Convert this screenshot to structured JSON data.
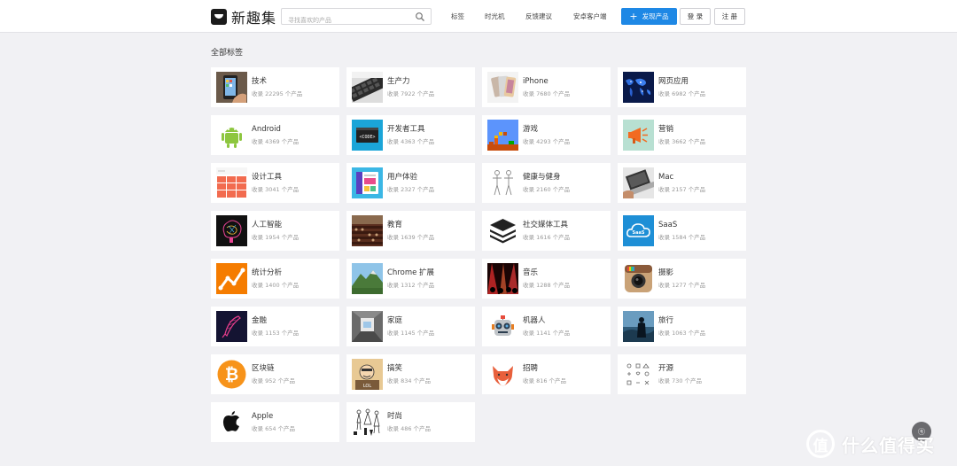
{
  "header": {
    "logo_text": "新趣集",
    "search_placeholder": "寻找喜欢的产品",
    "nav": [
      "标签",
      "时光机",
      "反馈建议",
      "安卓客户端"
    ],
    "post_button": "发现产品",
    "login": "登 录",
    "register": "注 册"
  },
  "main": {
    "section_title": "全部标签",
    "tags": [
      {
        "name": "技术",
        "count": "收录 22295 个产品",
        "icon": "iphone-hand-icon"
      },
      {
        "name": "生产力",
        "count": "收录 7922 个产品",
        "icon": "keyboard-icon"
      },
      {
        "name": "iPhone",
        "count": "收录 7680 个产品",
        "icon": "iphone-devices-icon"
      },
      {
        "name": "网页应用",
        "count": "收录 6982 个产品",
        "icon": "world-map-icon"
      },
      {
        "name": "Android",
        "count": "收录 4369 个产品",
        "icon": "android-robot-icon"
      },
      {
        "name": "开发者工具",
        "count": "收录 4363 个产品",
        "icon": "code-window-icon"
      },
      {
        "name": "游戏",
        "count": "收录 4293 个产品",
        "icon": "pixel-game-icon"
      },
      {
        "name": "营销",
        "count": "收录 3662 个产品",
        "icon": "megaphone-icon"
      },
      {
        "name": "设计工具",
        "count": "收录 3041 个产品",
        "icon": "design-grid-icon"
      },
      {
        "name": "用户体验",
        "count": "收录 2327 个产品",
        "icon": "ux-screen-icon"
      },
      {
        "name": "健康与健身",
        "count": "收录 2160 个产品",
        "icon": "body-figure-icon"
      },
      {
        "name": "Mac",
        "count": "收录 2157 个产品",
        "icon": "macbook-icon"
      },
      {
        "name": "人工智能",
        "count": "收录 1954 个产品",
        "icon": "neural-brain-icon"
      },
      {
        "name": "教育",
        "count": "收录 1639 个产品",
        "icon": "lecture-hall-icon"
      },
      {
        "name": "社交媒体工具",
        "count": "收录 1616 个产品",
        "icon": "layers-stack-icon"
      },
      {
        "name": "SaaS",
        "count": "收录 1584 个产品",
        "icon": "cloud-icon"
      },
      {
        "name": "统计分析",
        "count": "收录 1400 个产品",
        "icon": "analytics-chart-icon"
      },
      {
        "name": "Chrome 扩展",
        "count": "收录 1312 个产品",
        "icon": "mountain-landscape-icon"
      },
      {
        "name": "音乐",
        "count": "收录 1288 个产品",
        "icon": "concert-icon"
      },
      {
        "name": "摄影",
        "count": "收录 1277 个产品",
        "icon": "camera-app-icon"
      },
      {
        "name": "金融",
        "count": "收录 1153 个产品",
        "icon": "feather-icon"
      },
      {
        "name": "家庭",
        "count": "收录 1145 个产品",
        "icon": "room-interior-icon"
      },
      {
        "name": "机器人",
        "count": "收录 1141 个产品",
        "icon": "robot-head-icon"
      },
      {
        "name": "旅行",
        "count": "收录 1063 个产品",
        "icon": "traveler-silhouette-icon"
      },
      {
        "name": "区块链",
        "count": "收录 952 个产品",
        "icon": "bitcoin-icon"
      },
      {
        "name": "搞笑",
        "count": "收录 834 个产品",
        "icon": "comic-face-icon"
      },
      {
        "name": "招聘",
        "count": "收录 816 个产品",
        "icon": "fox-icon"
      },
      {
        "name": "开源",
        "count": "收录 730 个产品",
        "icon": "opensource-icons-icon"
      },
      {
        "name": "Apple",
        "count": "收录 654 个产品",
        "icon": "apple-logo-icon"
      },
      {
        "name": "时尚",
        "count": "收录 486 个产品",
        "icon": "fashion-sketch-icon"
      }
    ]
  },
  "float_button": "ⓠ",
  "watermark": {
    "logo": "值",
    "text": "什么值得买"
  },
  "colors": {
    "primary": "#1e88e5",
    "background": "#f1f1f4"
  }
}
